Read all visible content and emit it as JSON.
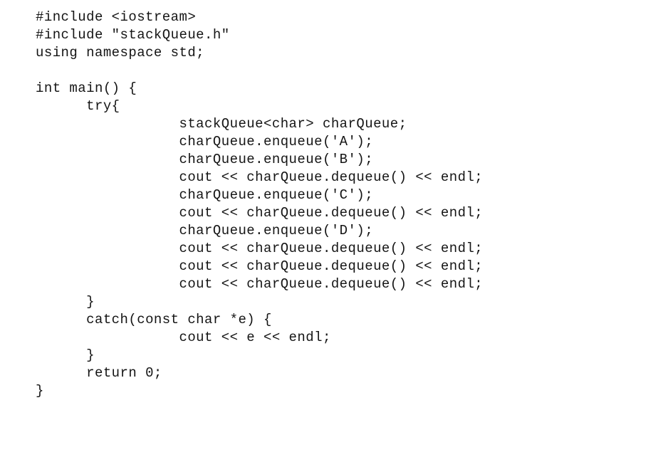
{
  "document": {
    "kind": "source-code-listing",
    "language": "cpp",
    "background_color": "#ffffff",
    "text_color": "#141414"
  },
  "code": {
    "lines": [
      {
        "indent": 0,
        "text": "#include <iostream>"
      },
      {
        "indent": 0,
        "text": "#include \"stackQueue.h\""
      },
      {
        "indent": 0,
        "text": "using namespace std;"
      },
      {
        "indent": 0,
        "text": ""
      },
      {
        "indent": 0,
        "text": "int main() {"
      },
      {
        "indent": 6,
        "text": "try{"
      },
      {
        "indent": 17,
        "text": "stackQueue<char> charQueue;"
      },
      {
        "indent": 17,
        "text": "charQueue.enqueue('A');"
      },
      {
        "indent": 17,
        "text": "charQueue.enqueue('B');"
      },
      {
        "indent": 17,
        "text": "cout << charQueue.dequeue() << endl;"
      },
      {
        "indent": 17,
        "text": "charQueue.enqueue('C');"
      },
      {
        "indent": 17,
        "text": "cout << charQueue.dequeue() << endl;"
      },
      {
        "indent": 17,
        "text": "charQueue.enqueue('D');"
      },
      {
        "indent": 17,
        "text": "cout << charQueue.dequeue() << endl;"
      },
      {
        "indent": 17,
        "text": "cout << charQueue.dequeue() << endl;"
      },
      {
        "indent": 17,
        "text": "cout << charQueue.dequeue() << endl;"
      },
      {
        "indent": 6,
        "text": "}"
      },
      {
        "indent": 6,
        "text": "catch(const char *e) {"
      },
      {
        "indent": 17,
        "text": "cout << e << endl;"
      },
      {
        "indent": 6,
        "text": "}"
      },
      {
        "indent": 6,
        "text": "return 0;"
      },
      {
        "indent": 0,
        "text": "}"
      }
    ]
  }
}
